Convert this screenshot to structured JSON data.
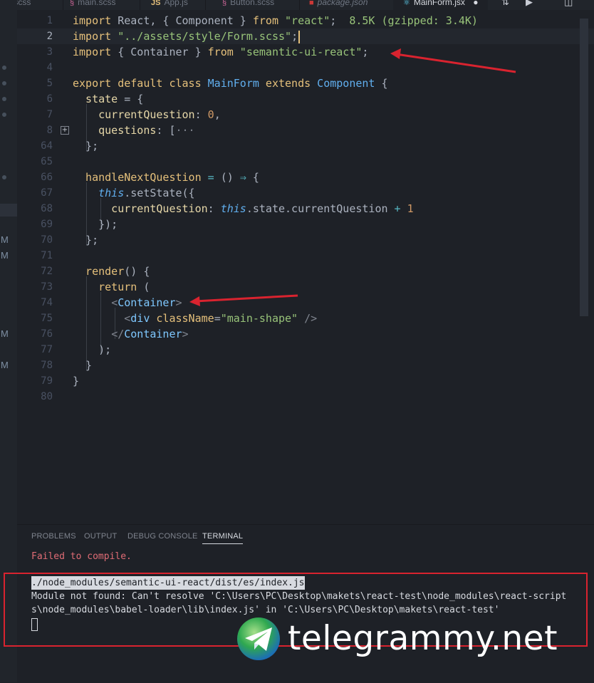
{
  "tabs": [
    {
      "label": "m.scss",
      "icon": "sass-icon",
      "color": "#cd6799"
    },
    {
      "label": "main.scss",
      "icon": "sass-icon",
      "color": "#cd6799"
    },
    {
      "label": "App.js",
      "icon": "js-icon",
      "color": "#e5c07b",
      "glyph": "JS"
    },
    {
      "label": "Button.scss",
      "icon": "sass-icon",
      "color": "#cd6799"
    },
    {
      "label": "package.json",
      "icon": "npm-icon",
      "color": "#cb3837"
    },
    {
      "label": "MainForm.jsx",
      "icon": "react-icon",
      "color": "#61dafb",
      "active": true
    }
  ],
  "lines": [
    {
      "num": "1"
    },
    {
      "num": "2"
    },
    {
      "num": "3"
    },
    {
      "num": "4"
    },
    {
      "num": "5"
    },
    {
      "num": "6"
    },
    {
      "num": "7"
    },
    {
      "num": "8"
    },
    {
      "num": "64"
    },
    {
      "num": "65"
    },
    {
      "num": "66"
    },
    {
      "num": "67"
    },
    {
      "num": "68"
    },
    {
      "num": "69"
    },
    {
      "num": "70"
    },
    {
      "num": "71"
    },
    {
      "num": "72"
    },
    {
      "num": "73"
    },
    {
      "num": "74"
    },
    {
      "num": "75"
    },
    {
      "num": "76"
    },
    {
      "num": "77"
    },
    {
      "num": "78"
    },
    {
      "num": "79"
    },
    {
      "num": "80"
    }
  ],
  "code": {
    "l1": {
      "import": "import",
      "a": " React, { Component } ",
      "from": "from",
      "s": " \"react\"",
      "semi": ";",
      "hint": "  8.5K (gzipped: 3.4K)"
    },
    "l2": {
      "import": "import",
      "s": " \"../assets/style/Form.scss\"",
      "semi": ";"
    },
    "l3": {
      "import": "import",
      "a": " { Container } ",
      "from": "from",
      "s": " \"semantic-ui-react\"",
      "semi": ";"
    },
    "l5": {
      "export": "export",
      "default": " default",
      "class": " class",
      "name": " MainForm",
      "extends": " extends",
      "base": " Component",
      "brace": " {"
    },
    "l6": {
      "prop": "  state",
      "rest": " = {"
    },
    "l7": {
      "prop": "    currentQuestion",
      "colon": ": ",
      "num": "0",
      "comma": ","
    },
    "l8": {
      "prop": "    questions",
      "colon": ": [",
      "ell": "···"
    },
    "l64": {
      "text": "  };"
    },
    "l66": {
      "fn": "  handleNextQuestion",
      "eq": " = ",
      "paren": "() ",
      "arrow": "⇒",
      "brace": " {"
    },
    "l67": {
      "indent": "    ",
      "this": "this",
      "call": ".setState({"
    },
    "l68": {
      "prop": "      currentQuestion",
      "colon": ": ",
      "this": "this",
      "rest": ".state.currentQuestion",
      "plus": " + ",
      "num": "1"
    },
    "l69": {
      "text": "    });"
    },
    "l70": {
      "text": "  };"
    },
    "l72": {
      "fn": "  render",
      "rest": "() {"
    },
    "l73": {
      "kw": "    return",
      "rest": " ("
    },
    "l74": {
      "indent": "      ",
      "lt": "<",
      "tag": "Container",
      "gt": ">"
    },
    "l75": {
      "indent": "        ",
      "lt": "<",
      "tag": "div",
      "attr": " className",
      "eq": "=",
      "val": "\"main-shape\"",
      "close": " />"
    },
    "l76": {
      "indent": "      ",
      "lt": "</",
      "tag": "Container",
      "gt": ">"
    },
    "l77": {
      "text": "    );"
    },
    "l78": {
      "text": "  }"
    },
    "l79": {
      "text": "}"
    }
  },
  "activity_badges": [
    "M",
    "M",
    "M",
    "M"
  ],
  "panel": {
    "tabs": [
      "PROBLEMS",
      "OUTPUT",
      "DEBUG CONSOLE",
      "TERMINAL"
    ],
    "active_tab": "TERMINAL",
    "terminal": {
      "failed": "Failed to compile.",
      "line1": "./node_modules/semantic-ui-react/dist/es/index.js",
      "line2": "Module not found: Can't resolve 'C:\\Users\\PC\\Desktop\\makets\\react-test\\node_modules\\react-script",
      "line3": "s\\node_modules\\babel-loader\\lib\\index.js' in 'C:\\Users\\PC\\Desktop\\makets\\react-test'"
    }
  },
  "watermark": {
    "text": "telegrammy.net",
    "icon": "telegram-logo-icon"
  },
  "colors": {
    "annotation": "#d9232f",
    "error": "#e06c75"
  }
}
